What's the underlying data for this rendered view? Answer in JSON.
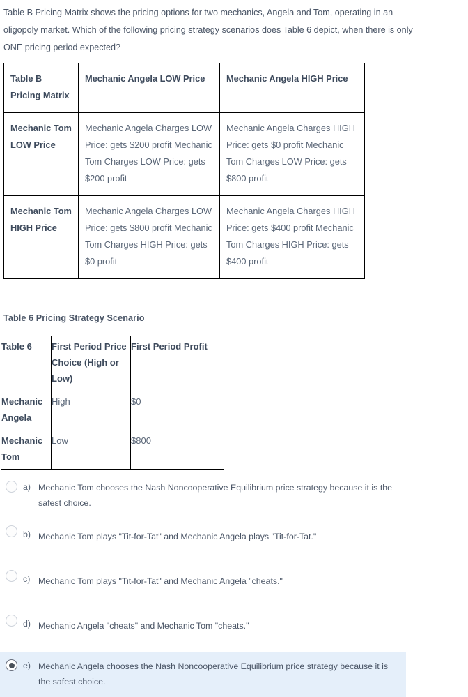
{
  "question": {
    "stem": "Table B Pricing Matrix shows the pricing options for two mechanics, Angela and Tom, operating in an oligopoly market. Which of the following pricing strategy scenarios does Table 6 depict, when there is only ONE pricing period expected?"
  },
  "matrix": {
    "corner_label": "Table B Pricing Matrix",
    "col_headers": [
      "Mechanic Angela LOW Price",
      "Mechanic Angela HIGH Price"
    ],
    "rows": [
      {
        "header": "Mechanic Tom LOW Price",
        "cells": [
          "Mechanic Angela Charges LOW Price: gets $200 profit   Mechanic Tom Charges LOW Price: gets $200 profit",
          "Mechanic Angela Charges HIGH Price: gets $0 profit Mechanic Tom Charges LOW Price: gets $800 profit"
        ]
      },
      {
        "header": "Mechanic Tom HIGH Price",
        "cells": [
          "Mechanic Angela Charges LOW Price: gets $800 profit   Mechanic Tom Charges HIGH Price: gets $0 profit",
          "Mechanic Angela Charges HIGH Price: gets $400 profit   Mechanic Tom Charges HIGH Price: gets $400 profit"
        ]
      }
    ]
  },
  "table6": {
    "caption": "Table 6 Pricing Strategy Scenario",
    "corner_label": "Table 6",
    "col_headers": [
      "First Period Price Choice (High or Low)",
      "First Period Profit"
    ],
    "rows": [
      {
        "header": "Mechanic Angela",
        "choice": "High",
        "profit": "$0"
      },
      {
        "header": "Mechanic Tom",
        "choice": "Low",
        "profit": "$800"
      }
    ]
  },
  "answers": {
    "selected": "e",
    "options": [
      {
        "letter": "a)",
        "text": "Mechanic Tom chooses the Nash Noncooperative Equilibrium price strategy because it is the safest choice."
      },
      {
        "letter": "b)",
        "text": "Mechanic Tom plays \"Tit-for-Tat\" and Mechanic Angela plays \"Tit-for-Tat.\""
      },
      {
        "letter": "c)",
        "text": "Mechanic Tom plays \"Tit-for-Tat\" and Mechanic Angela \"cheats.\""
      },
      {
        "letter": "d)",
        "text": "Mechanic Angela \"cheats\" and Mechanic Tom \"cheats.\""
      },
      {
        "letter": "e)",
        "text": "Mechanic Angela chooses the Nash Noncooperative Equilibrium price strategy because it is the safest choice."
      }
    ]
  },
  "colors": {
    "selected_highlight": "#e5effa",
    "text": "#4a5566",
    "border": "#000000"
  }
}
